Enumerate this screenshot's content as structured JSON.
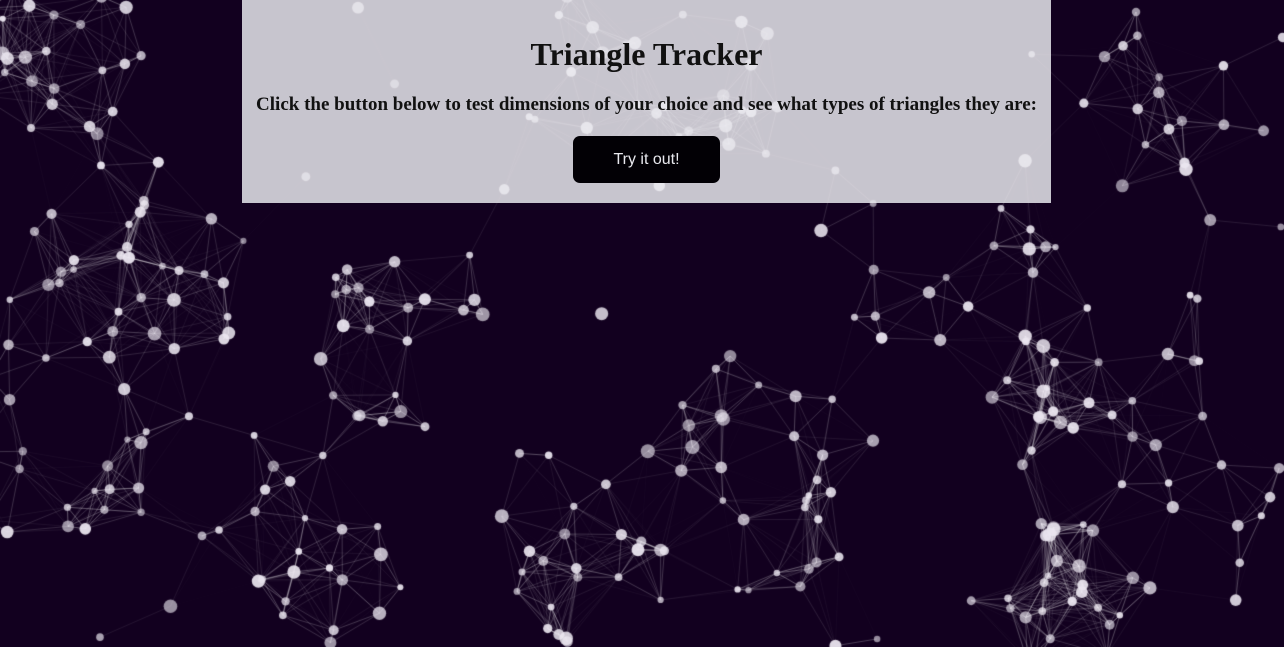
{
  "header": {
    "title": "Triangle Tracker",
    "instructions": "Click the button below to test dimensions of your choice and see what types of triangles they are:",
    "button_label": "Try it out!"
  },
  "theme": {
    "background": "#12001f",
    "panel": "#ebebf0",
    "button": "#020005",
    "particle": "#ffffff"
  }
}
